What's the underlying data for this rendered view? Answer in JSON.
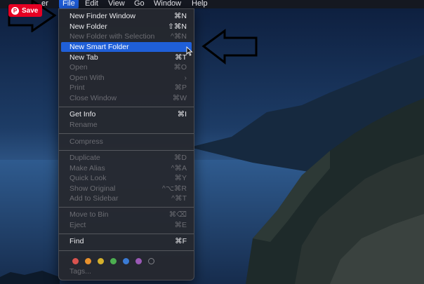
{
  "menubar": {
    "items": [
      {
        "label": "er"
      },
      {
        "label": "File"
      },
      {
        "label": "Edit"
      },
      {
        "label": "View"
      },
      {
        "label": "Go"
      },
      {
        "label": "Window"
      },
      {
        "label": "Help"
      }
    ]
  },
  "pin": {
    "label": "Save",
    "color": "#e60023"
  },
  "file_menu": {
    "new_finder_window": {
      "label": "New Finder Window",
      "shortcut": "⌘N"
    },
    "new_folder": {
      "label": "New Folder",
      "shortcut": "⇧⌘N"
    },
    "new_folder_selection": {
      "label": "New Folder with Selection",
      "shortcut": "^⌘N"
    },
    "new_smart_folder": {
      "label": "New Smart Folder"
    },
    "new_tab": {
      "label": "New Tab",
      "shortcut": "⌘T"
    },
    "open": {
      "label": "Open",
      "shortcut": "⌘O"
    },
    "open_with": {
      "label": "Open With",
      "shortcut": "›"
    },
    "print": {
      "label": "Print",
      "shortcut": "⌘P"
    },
    "close_window": {
      "label": "Close Window",
      "shortcut": "⌘W"
    },
    "get_info": {
      "label": "Get Info",
      "shortcut": "⌘I"
    },
    "rename": {
      "label": "Rename"
    },
    "compress": {
      "label": "Compress"
    },
    "duplicate": {
      "label": "Duplicate",
      "shortcut": "⌘D"
    },
    "make_alias": {
      "label": "Make Alias",
      "shortcut": "^⌘A"
    },
    "quick_look": {
      "label": "Quick Look",
      "shortcut": "⌘Y"
    },
    "show_original": {
      "label": "Show Original",
      "shortcut": "^⌥⌘R"
    },
    "add_to_sidebar": {
      "label": "Add to Sidebar",
      "shortcut": "^⌘T"
    },
    "move_to_bin": {
      "label": "Move to Bin",
      "shortcut": "⌘⌫"
    },
    "eject": {
      "label": "Eject",
      "shortcut": "⌘E"
    },
    "find": {
      "label": "Find",
      "shortcut": "⌘F"
    },
    "tags": {
      "label": "Tags..."
    },
    "tag_colors": [
      "#d9534f",
      "#e8912d",
      "#d4b02c",
      "#4caf50",
      "#3a7bd5",
      "#9b59b6"
    ]
  },
  "colors": {
    "highlight": "#1f5fd8",
    "menu_bg": "#26282e"
  }
}
